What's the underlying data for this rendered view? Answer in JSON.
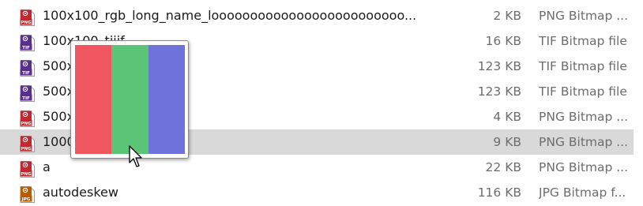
{
  "files": [
    {
      "name": "100x100_rgb_long_name_looooooooooooooooooooooooo...",
      "size": "2 KB",
      "type": "PNG Bitmap ...",
      "icon": "png-file-icon",
      "badge": "PNG",
      "badge_color": "#c1272d",
      "selected": false
    },
    {
      "name": "100x100_tiiif",
      "size": "16 KB",
      "type": "TIF Bitmap file",
      "icon": "tif-file-icon",
      "badge": "TIF",
      "badge_color": "#5b2d8e",
      "selected": false
    },
    {
      "name": "500x",
      "size": "123 KB",
      "type": "TIF Bitmap file",
      "icon": "tif-file-icon",
      "badge": "TIF",
      "badge_color": "#5b2d8e",
      "selected": false
    },
    {
      "name": "500x",
      "size": "123 KB",
      "type": "TIF Bitmap file",
      "icon": "tif-file-icon",
      "badge": "TIF",
      "badge_color": "#5b2d8e",
      "selected": false
    },
    {
      "name": "500x",
      "size": "4 KB",
      "type": "PNG Bitmap ...",
      "icon": "png-file-icon",
      "badge": "PNG",
      "badge_color": "#c1272d",
      "selected": false
    },
    {
      "name": "1000",
      "size": "9 KB",
      "type": "PNG Bitmap ...",
      "icon": "png-file-icon",
      "badge": "PNG",
      "badge_color": "#c1272d",
      "selected": true
    },
    {
      "name": "a",
      "size": "22 KB",
      "type": "PNG Bitmap ...",
      "icon": "png-file-icon",
      "badge": "PNG",
      "badge_color": "#c1272d",
      "selected": false
    },
    {
      "name": "autodeskew",
      "size": "116 KB",
      "type": "JPG Bitmap f...",
      "icon": "jpg-file-icon",
      "badge": "JPG",
      "badge_color": "#b85c00",
      "selected": false
    }
  ],
  "thumbnail_tooltip": {
    "swatch_colors": [
      "#f0565f",
      "#5ac577",
      "#7072dc"
    ]
  },
  "colors": {
    "selection": "#d9d9d9",
    "secondary_text": "#6d6d6d"
  }
}
